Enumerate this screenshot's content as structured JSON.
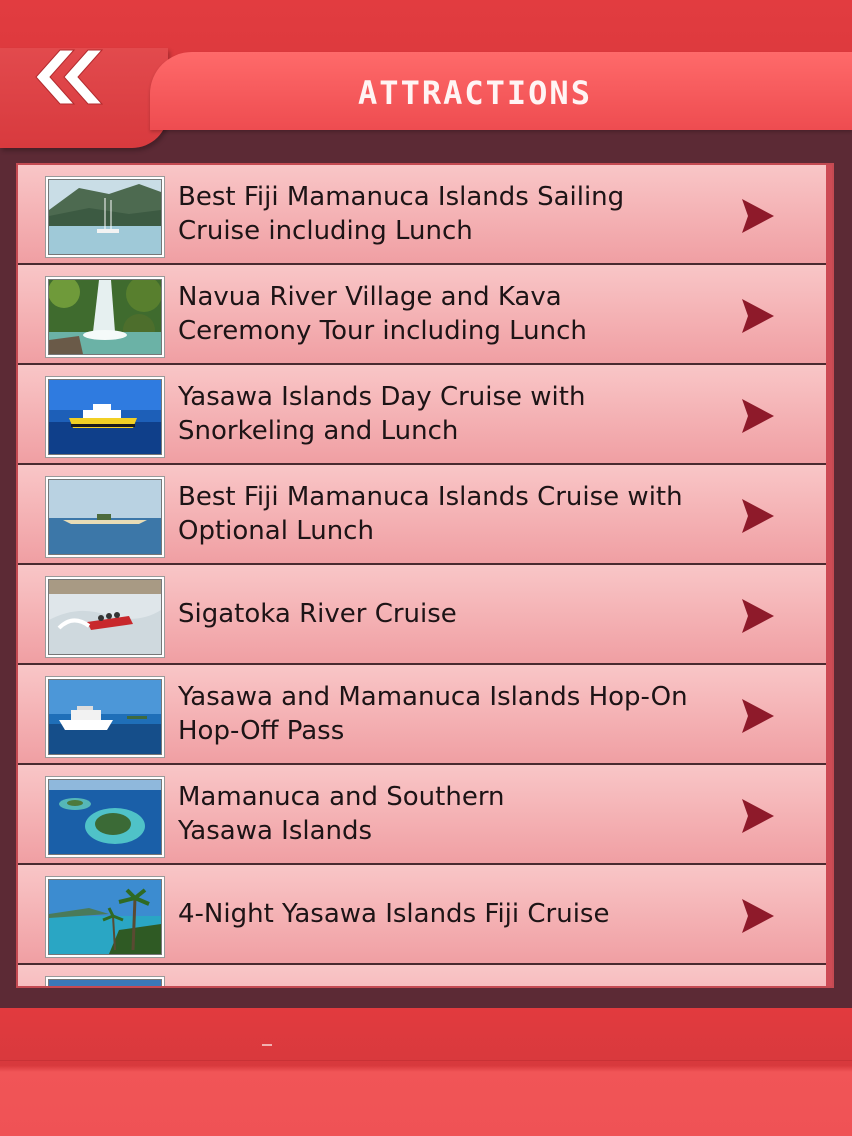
{
  "header": {
    "title": "ATTRACTIONS",
    "back_icon": "double-chevron-left-icon"
  },
  "colors": {
    "topbar": "#d93a3e",
    "title_bar": "#f45a5c",
    "panel": "#5c2a35",
    "row_gradient_top": "#f9c6c7",
    "row_gradient_bottom": "#f09fa3",
    "arrow": "#8e1a2a"
  },
  "attractions": [
    {
      "label": "Best Fiji Mamanuca Islands Sailing\nCruise including Lunch",
      "thumbnail": "sailboat-bay-photo"
    },
    {
      "label": "Navua River Village and Kava\nCeremony Tour including Lunch",
      "thumbnail": "waterfall-photo"
    },
    {
      "label": "Yasawa Islands Day Cruise with\nSnorkeling and Lunch",
      "thumbnail": "yellow-cruise-boat-photo"
    },
    {
      "label": "Best Fiji Mamanuca Islands Cruise with\nOptional Lunch",
      "thumbnail": "sandbar-island-photo"
    },
    {
      "label": "Sigatoka River Cruise",
      "thumbnail": "jet-boat-photo"
    },
    {
      "label": "Yasawa and Mamanuca Islands Hop-On\nHop-Off Pass",
      "thumbnail": "catamaran-ferry-photo"
    },
    {
      "label": " Mamanuca and Southern\nYasawa Islands",
      "thumbnail": "aerial-island-photo"
    },
    {
      "label": "4-Night Yasawa Islands Fiji Cruise",
      "thumbnail": "palm-beach-photo"
    },
    {
      "label": "",
      "thumbnail": "partial-photo"
    }
  ]
}
